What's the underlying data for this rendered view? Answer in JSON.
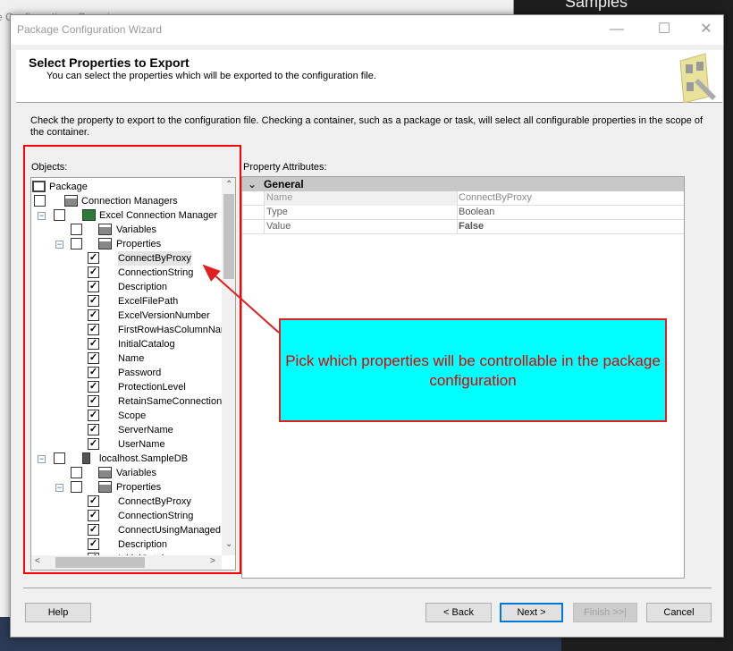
{
  "background": {
    "window_title": "e Configurations Organizer",
    "right_panel_title": "Samples"
  },
  "window": {
    "title": "Package Configuration Wizard",
    "minimize": "—",
    "maximize": "☐",
    "close": "✕"
  },
  "header": {
    "title": "Select Properties to Export",
    "subtitle": "You can select the properties which will be exported to the configuration file."
  },
  "instructions": "Check the property to export to the configuration file. Checking a container, such as a package or task, will select all configurable properties in the scope of the container.",
  "objects": {
    "label": "Objects:",
    "tree": [
      {
        "label": "Package",
        "level": 0,
        "icon": "package-icon"
      },
      {
        "label": "Connection Managers",
        "level": 1,
        "checked": false,
        "icon": "folder-icon"
      },
      {
        "label": "Excel Connection Manager",
        "level": 2,
        "checked": false,
        "expanded": true,
        "icon": "excel-icon"
      },
      {
        "label": "Variables",
        "level": 3,
        "checked": false,
        "icon": "folder-icon"
      },
      {
        "label": "Properties",
        "level": 3,
        "checked": false,
        "expanded": true,
        "icon": "folder-icon"
      },
      {
        "label": "ConnectByProxy",
        "level": 4,
        "checked": true,
        "selected": true
      },
      {
        "label": "ConnectionString",
        "level": 4,
        "checked": true
      },
      {
        "label": "Description",
        "level": 4,
        "checked": true
      },
      {
        "label": "ExcelFilePath",
        "level": 4,
        "checked": true
      },
      {
        "label": "ExcelVersionNumber",
        "level": 4,
        "checked": true
      },
      {
        "label": "FirstRowHasColumnNam",
        "level": 4,
        "checked": true
      },
      {
        "label": "InitialCatalog",
        "level": 4,
        "checked": true
      },
      {
        "label": "Name",
        "level": 4,
        "checked": true
      },
      {
        "label": "Password",
        "level": 4,
        "checked": true
      },
      {
        "label": "ProtectionLevel",
        "level": 4,
        "checked": true
      },
      {
        "label": "RetainSameConnection",
        "level": 4,
        "checked": true
      },
      {
        "label": "Scope",
        "level": 4,
        "checked": true
      },
      {
        "label": "ServerName",
        "level": 4,
        "checked": true
      },
      {
        "label": "UserName",
        "level": 4,
        "checked": true
      },
      {
        "label": "localhost.SampleDB",
        "level": 2,
        "checked": false,
        "expanded": true,
        "icon": "database-icon"
      },
      {
        "label": "Variables",
        "level": 3,
        "checked": false,
        "icon": "folder-icon"
      },
      {
        "label": "Properties",
        "level": 3,
        "checked": false,
        "expanded": true,
        "icon": "folder-icon"
      },
      {
        "label": "ConnectByProxy",
        "level": 4,
        "checked": true
      },
      {
        "label": "ConnectionString",
        "level": 4,
        "checked": true
      },
      {
        "label": "ConnectUsingManagedI",
        "level": 4,
        "checked": true
      },
      {
        "label": "Description",
        "level": 4,
        "checked": true
      },
      {
        "label": "InitialCatal",
        "level": 4,
        "checked": true
      }
    ]
  },
  "properties": {
    "label": "Property Attributes:",
    "category": "General",
    "rows": [
      {
        "key": "Name",
        "value": "ConnectByProxy"
      },
      {
        "key": "Type",
        "value": "Boolean"
      },
      {
        "key": "Value",
        "value": "False"
      }
    ]
  },
  "callout": {
    "text": "Pick which properties will be controllable in the package configuration",
    "background": "#00ffff",
    "color": "#e00000"
  },
  "buttons": {
    "help": "Help",
    "back": "< Back",
    "next": "Next >",
    "finish": "Finish >>|",
    "cancel": "Cancel"
  }
}
